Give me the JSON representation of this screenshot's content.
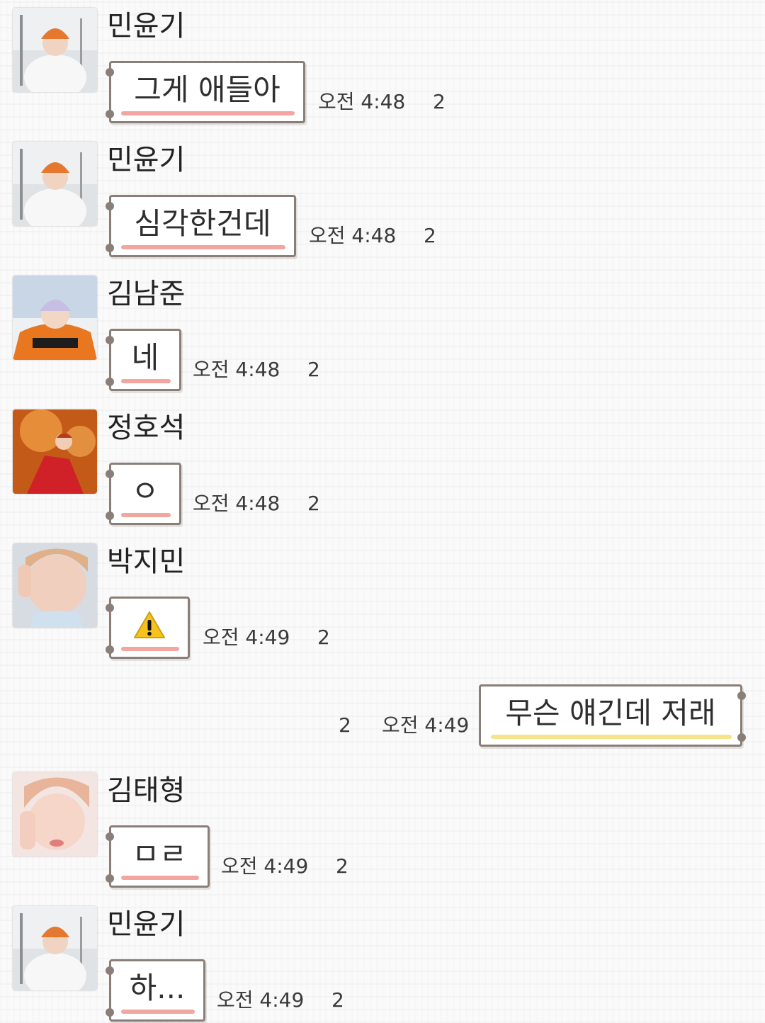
{
  "messages": [
    {
      "sender": "민윤기",
      "text": "그게 애들아",
      "time": "오전 4:48",
      "unread": "2"
    },
    {
      "sender": "민윤기",
      "text": "심각한건데",
      "time": "오전 4:48",
      "unread": "2"
    },
    {
      "sender": "김남준",
      "text": "네",
      "time": "오전 4:48",
      "unread": "2"
    },
    {
      "sender": "정호석",
      "text": "ㅇ",
      "time": "오전 4:48",
      "unread": "2"
    },
    {
      "sender": "박지민",
      "icon": "warning-icon",
      "time": "오전 4:49",
      "unread": "2"
    },
    {
      "sender": "",
      "text": "무슨 얘긴데 저래",
      "time": "오전 4:49",
      "unread": "2",
      "mine": true
    },
    {
      "sender": "김태형",
      "text": "ㅁㄹ",
      "time": "오전 4:49",
      "unread": "2"
    },
    {
      "sender": "민윤기",
      "text": "하...",
      "time": "오전 4:49",
      "unread": "2"
    }
  ],
  "colors": {
    "received_underline": "#f3a6a0",
    "sent_underline": "#f6e48a",
    "bubble_border": "#8a7f78"
  }
}
